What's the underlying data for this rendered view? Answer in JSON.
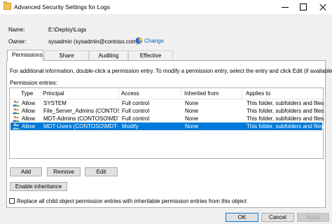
{
  "window": {
    "title": "Advanced Security Settings for Logs"
  },
  "header": {
    "name_label": "Name:",
    "name_value": "E:\\Deploy\\Logs",
    "owner_label": "Owner:",
    "owner_value": "sysadmin (sysadmin@contoso.com)",
    "change_label": "Change"
  },
  "tabs": [
    {
      "label": "Permissions",
      "active": true
    },
    {
      "label": "Share"
    },
    {
      "label": "Auditing"
    },
    {
      "label": "Effective Access"
    }
  ],
  "info_text": "For additional information, double-click a permission entry. To modify a permission entry, select the entry and click Edit (if available).",
  "entries_label": "Permission entries:",
  "columns": [
    "Type",
    "Principal",
    "Access",
    "Inherited from",
    "Applies to"
  ],
  "entries": [
    {
      "type": "Allow",
      "principal": "SYSTEM",
      "access": "Full control",
      "inherited": "None",
      "applies": "This folder, subfolders and files"
    },
    {
      "type": "Allow",
      "principal": "File_Server_Admins (CONTOS...",
      "access": "Full control",
      "inherited": "None",
      "applies": "This folder, subfolders and files"
    },
    {
      "type": "Allow",
      "principal": "MDT-Admins (CONTOSO\\MDT-...",
      "access": "Full control",
      "inherited": "None",
      "applies": "This folder, subfolders and files"
    },
    {
      "type": "Allow",
      "principal": "MDT-Users (CONTOSO\\MDT-...",
      "access": "Modify",
      "inherited": "None",
      "applies": "This folder, subfolders and files",
      "selected": true
    }
  ],
  "buttons": {
    "add": "Add",
    "remove": "Remove",
    "edit": "Edit",
    "enable_inheritance": "Enable inheritance",
    "ok": "OK",
    "cancel": "Cancel",
    "apply": "Apply"
  },
  "replace_checkbox_label": "Replace all child object permission entries with inheritable permission entries from this object",
  "colors": {
    "selection": "#0078d7",
    "link": "#0563c1"
  }
}
